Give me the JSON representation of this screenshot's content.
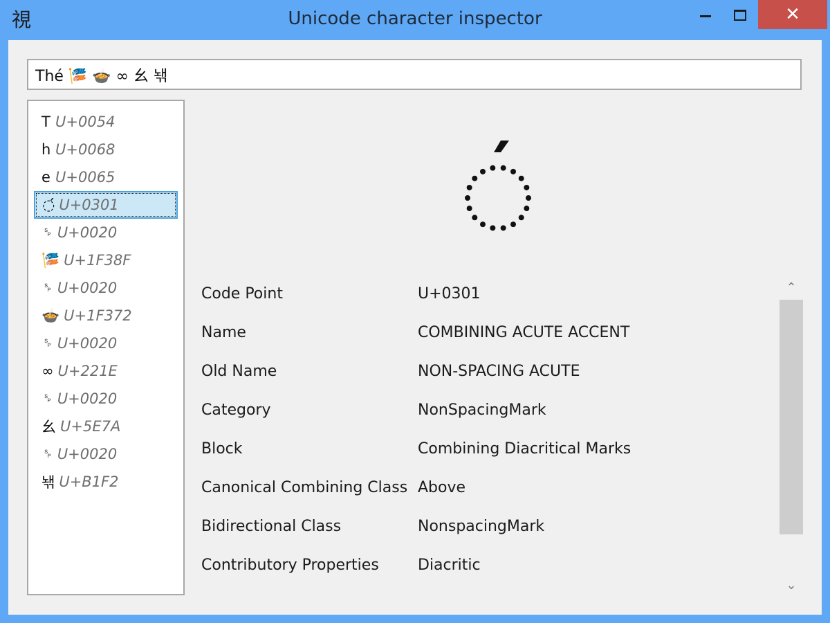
{
  "window": {
    "title": "Unicode character inspector",
    "app_icon_glyph": "視",
    "close_glyph": "✕"
  },
  "input": {
    "value": "Thé 🎏 🍲 ∞ 幺 놲"
  },
  "char_list": {
    "items": [
      {
        "glyph": "T",
        "code": "U+0054"
      },
      {
        "glyph": "h",
        "code": "U+0068"
      },
      {
        "glyph": "e",
        "code": "U+0065"
      },
      {
        "glyph": "◌́",
        "code": "U+0301",
        "selected": true
      },
      {
        "glyph": "␠",
        "code": "U+0020"
      },
      {
        "glyph": "🎏",
        "code": "U+1F38F"
      },
      {
        "glyph": "␠",
        "code": "U+0020"
      },
      {
        "glyph": "🍲",
        "code": "U+1F372"
      },
      {
        "glyph": "␠",
        "code": "U+0020"
      },
      {
        "glyph": "∞",
        "code": "U+221E"
      },
      {
        "glyph": "␠",
        "code": "U+0020"
      },
      {
        "glyph": "幺",
        "code": "U+5E7A"
      },
      {
        "glyph": "␠",
        "code": "U+0020"
      },
      {
        "glyph": "놲",
        "code": "U+B1F2"
      }
    ]
  },
  "properties": [
    {
      "label": "Code Point",
      "value": "U+0301"
    },
    {
      "label": "Name",
      "value": "COMBINING ACUTE ACCENT"
    },
    {
      "label": "Old Name",
      "value": "NON-SPACING ACUTE"
    },
    {
      "label": "Category",
      "value": "NonSpacingMark"
    },
    {
      "label": "Block",
      "value": "Combining Diacritical Marks"
    },
    {
      "label": "Canonical Combining Class",
      "value": "Above"
    },
    {
      "label": "Bidirectional Class",
      "value": "NonspacingMark"
    },
    {
      "label": "Contributory Properties",
      "value": "Diacritic"
    }
  ],
  "scroll": {
    "up_glyph": "⌃",
    "down_glyph": "⌄"
  }
}
